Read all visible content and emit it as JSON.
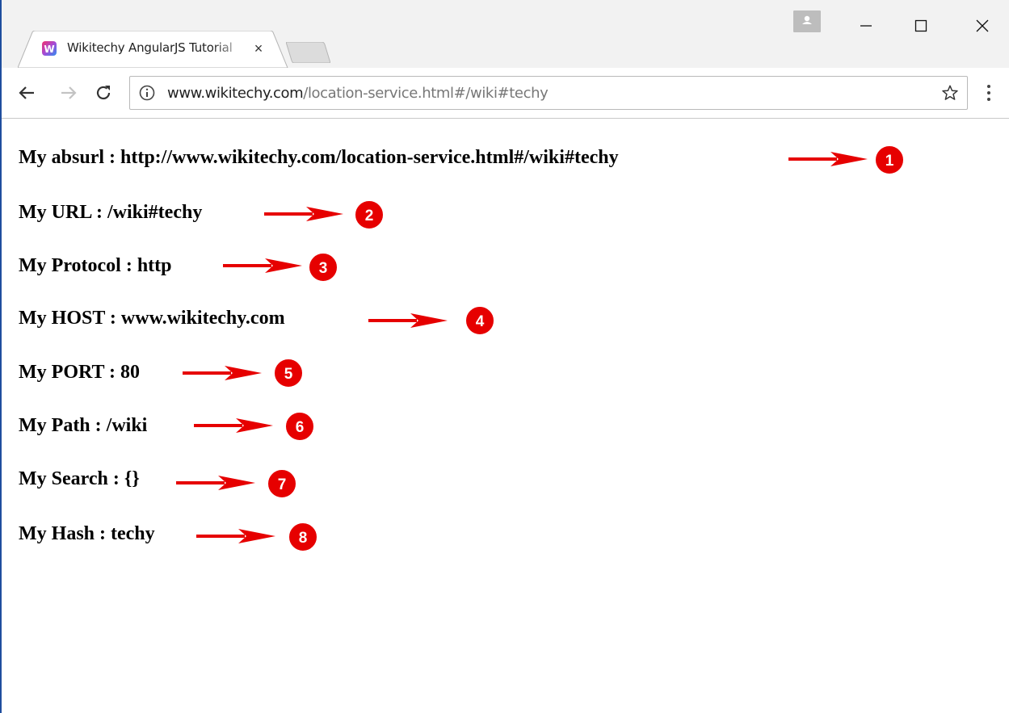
{
  "browser": {
    "tab_title": "Wikitechy AngularJS Tutorial",
    "tab_close": "×",
    "url_host": "www.wikitechy.com",
    "url_rest": "/location-service.html#/wiki#techy"
  },
  "content": {
    "lines": [
      {
        "text": "My absurl : http://www.wikitechy.com/location-service.html#/wiki#techy",
        "badge": "1"
      },
      {
        "text": "My URL : /wiki#techy",
        "badge": "2"
      },
      {
        "text": "My Protocol : http",
        "badge": "3"
      },
      {
        "text": "My HOST : www.wikitechy.com",
        "badge": "4"
      },
      {
        "text": "My PORT : 80",
        "badge": "5"
      },
      {
        "text": "My Path : /wiki",
        "badge": "6"
      },
      {
        "text": "My Search : {}",
        "badge": "7"
      },
      {
        "text": "My Hash : techy",
        "badge": "8"
      }
    ]
  },
  "colors": {
    "annotation_red": "#e60000",
    "window_border": "#1f4e9e"
  },
  "icons": [
    "favicon-icon",
    "close-icon",
    "profile-icon",
    "minimize-icon",
    "maximize-icon",
    "window-close-icon",
    "back-arrow-icon",
    "forward-arrow-icon",
    "reload-icon",
    "info-icon",
    "star-icon",
    "menu-dots-icon",
    "red-arrow-icon",
    "number-badge-icon"
  ]
}
